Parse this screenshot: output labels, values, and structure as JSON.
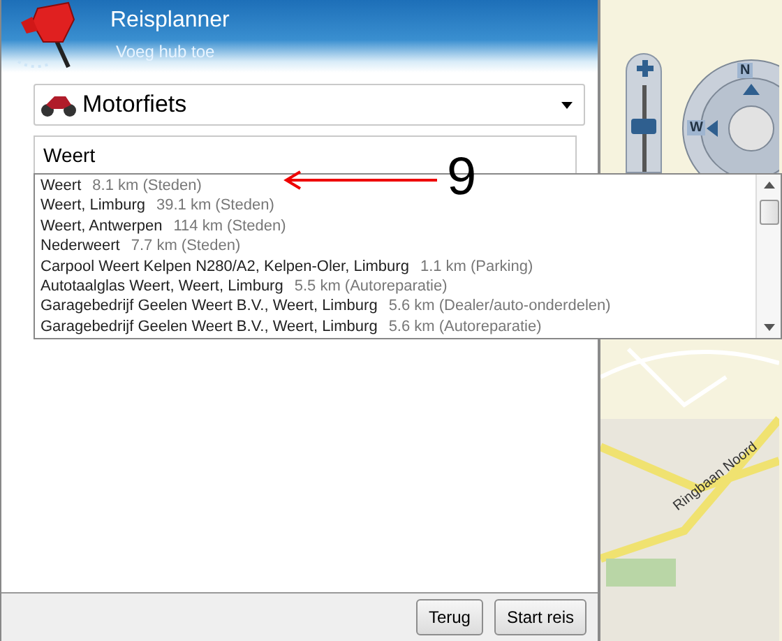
{
  "header": {
    "title": "Reisplanner",
    "subtitle": "Voeg hub toe"
  },
  "vehicle": {
    "value": "Motorfiets"
  },
  "search": {
    "value": "Weert"
  },
  "suggestions": [
    {
      "name": "Weert",
      "detail": "8.1 km (Steden)"
    },
    {
      "name": "Weert, Limburg",
      "detail": "39.1 km (Steden)"
    },
    {
      "name": "Weert, Antwerpen",
      "detail": "114 km (Steden)"
    },
    {
      "name": "Nederweert",
      "detail": "7.7 km (Steden)"
    },
    {
      "name": "Carpool Weert Kelpen N280/A2, Kelpen-Oler, Limburg",
      "detail": "1.1 km (Parking)"
    },
    {
      "name": "Autotaalglas Weert, Weert, Limburg",
      "detail": "5.5 km (Autoreparatie)"
    },
    {
      "name": "Garagebedrijf Geelen Weert B.V., Weert, Limburg",
      "detail": "5.6 km (Dealer/auto-onderdelen)"
    },
    {
      "name": "Garagebedrijf Geelen Weert B.V., Weert, Limburg",
      "detail": "5.6 km (Autoreparatie)"
    }
  ],
  "annotation": {
    "label": "9"
  },
  "map": {
    "zoom_slider": {
      "level": 0.62
    },
    "compass": {
      "north": "N",
      "west": "W"
    },
    "street_label": "Ringbaan Noord"
  },
  "buttons": [
    {
      "label": "Terug"
    },
    {
      "label": "Start reis"
    }
  ]
}
